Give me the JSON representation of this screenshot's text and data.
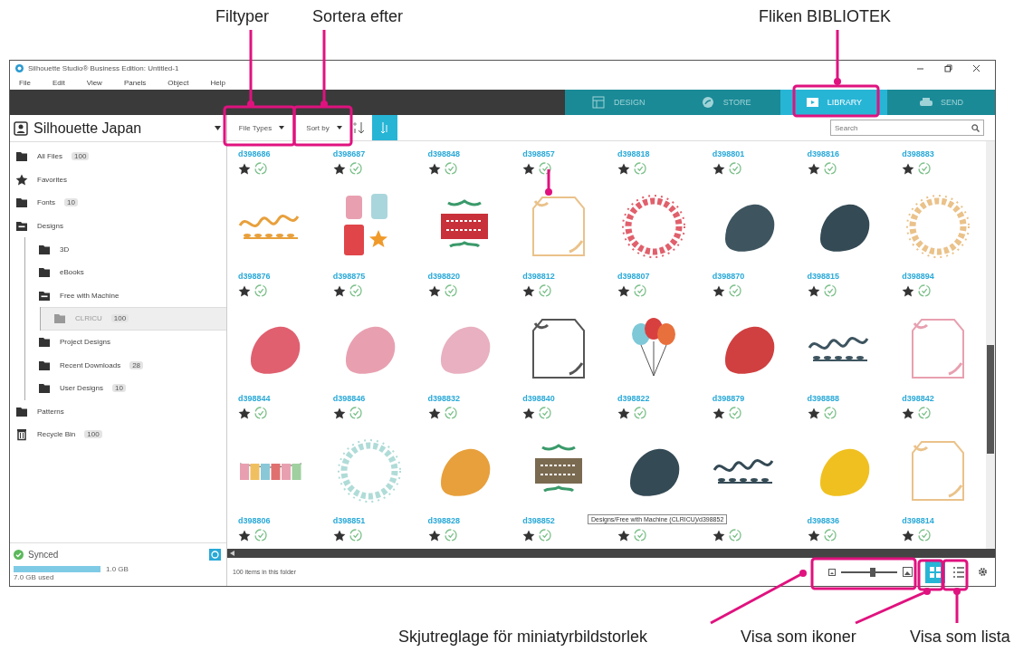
{
  "callouts": [
    {
      "label": "Filtyper"
    },
    {
      "label": "Sortera efter"
    },
    {
      "label": "Fliken BIBLIOTEK"
    },
    {
      "label": "Skjutreglage för miniatyrbildstorlek"
    },
    {
      "label": "Visa som ikoner"
    },
    {
      "label": "Visa som lista"
    }
  ],
  "window": {
    "title": "Silhouette Studio® Business Edition: Untitled-1"
  },
  "menu": [
    "File",
    "Edit",
    "View",
    "Panels",
    "Object",
    "Help"
  ],
  "tabs": [
    {
      "kind": "design",
      "label": "DESIGN",
      "selected": false
    },
    {
      "kind": "store",
      "label": "STORE",
      "selected": false
    },
    {
      "kind": "library",
      "label": "LIBRARY",
      "selected": true
    },
    {
      "kind": "send",
      "label": "SEND",
      "selected": false
    }
  ],
  "sidebar": {
    "account": "Silhouette Japan",
    "items": [
      {
        "kind": "folder",
        "label": "All Files",
        "count": "100",
        "selected": false
      },
      {
        "kind": "star",
        "label": "Favorites",
        "selected": false
      },
      {
        "kind": "folder",
        "label": "Fonts",
        "count": "10",
        "selected": false
      },
      {
        "kind": "folder",
        "label": "Designs",
        "selected": false,
        "expanded": true,
        "children": [
          {
            "kind": "folder",
            "label": "3D",
            "selected": false
          },
          {
            "kind": "folder",
            "label": "eBooks",
            "selected": false
          },
          {
            "kind": "folder",
            "label": "Free with Machine",
            "selected": false,
            "expanded": true,
            "children": [
              {
                "kind": "folder",
                "label": "CLRICU",
                "count": "100",
                "selected": true
              }
            ]
          },
          {
            "kind": "folder",
            "label": "Project Designs",
            "selected": false
          },
          {
            "kind": "folder",
            "label": "Recent Downloads",
            "count": "28",
            "selected": false
          },
          {
            "kind": "folder",
            "label": "User Designs",
            "count": "10",
            "selected": false
          }
        ]
      },
      {
        "kind": "folder",
        "label": "Patterns",
        "selected": false
      },
      {
        "kind": "trash",
        "label": "Recycle Bin",
        "count": "100",
        "selected": false
      }
    ],
    "sync": {
      "status": "Synced"
    },
    "storage": {
      "level": 1,
      "reading": "1.0 GB",
      "caption": "7.0 GB used"
    }
  },
  "toolbar": {
    "file_types": "File Types",
    "sort_by": "Sort by",
    "sort_toggle": {
      "selected": true
    },
    "search": {
      "placeholder": "Search"
    }
  },
  "grid": {
    "tooltip": "Designs/Free with Machine (CLRICU)/d398852",
    "items": [
      {
        "id": "d398686",
        "favorite": true
      },
      {
        "id": "d398687",
        "favorite": true
      },
      {
        "id": "d398848",
        "favorite": true
      },
      {
        "id": "d398857",
        "favorite": true
      },
      {
        "id": "d398818",
        "favorite": true
      },
      {
        "id": "d398801",
        "favorite": true
      },
      {
        "id": "d398816",
        "favorite": true
      },
      {
        "id": "d398883",
        "favorite": true
      },
      {
        "id": "d398876",
        "favorite": true,
        "thumb": {
          "kind": "lettering",
          "color": "#e8a03c"
        }
      },
      {
        "id": "d398875",
        "favorite": true,
        "thumb": {
          "kind": "tags",
          "color": "#e8a0b0"
        }
      },
      {
        "id": "d398820",
        "favorite": true,
        "thumb": {
          "kind": "banner",
          "color": "#c8303a"
        }
      },
      {
        "id": "d398812",
        "favorite": true,
        "thumb": {
          "kind": "frame",
          "color": "#eac28a"
        }
      },
      {
        "id": "d398807",
        "favorite": true,
        "thumb": {
          "kind": "wreath",
          "color": "#e0606c"
        }
      },
      {
        "id": "d398870",
        "favorite": true,
        "thumb": {
          "kind": "blob",
          "color": "#3e5560"
        }
      },
      {
        "id": "d398815",
        "favorite": true,
        "thumb": {
          "kind": "blob",
          "color": "#344a55"
        }
      },
      {
        "id": "d398894",
        "favorite": true,
        "thumb": {
          "kind": "wreath",
          "color": "#eac28a"
        }
      },
      {
        "id": "d398844",
        "favorite": true,
        "thumb": {
          "kind": "blob",
          "color": "#e06070"
        }
      },
      {
        "id": "d398846",
        "favorite": true,
        "thumb": {
          "kind": "blob",
          "color": "#e8a0b0"
        }
      },
      {
        "id": "d398832",
        "favorite": true,
        "thumb": {
          "kind": "blob",
          "color": "#e8b0c0"
        }
      },
      {
        "id": "d398840",
        "favorite": true,
        "thumb": {
          "kind": "frame",
          "color": "#555555"
        }
      },
      {
        "id": "d398822",
        "favorite": true,
        "thumb": {
          "kind": "balloons",
          "color": "#e8703c"
        }
      },
      {
        "id": "d398879",
        "favorite": true,
        "thumb": {
          "kind": "blob",
          "color": "#d04040"
        }
      },
      {
        "id": "d398888",
        "favorite": true,
        "thumb": {
          "kind": "lettering",
          "color": "#3e5560"
        }
      },
      {
        "id": "d398842",
        "favorite": true,
        "thumb": {
          "kind": "frame",
          "color": "#e8a0b0"
        }
      },
      {
        "id": "d398806",
        "favorite": true,
        "thumb": {
          "kind": "bunting",
          "color": "#e8a0b0"
        }
      },
      {
        "id": "d398851",
        "favorite": true,
        "thumb": {
          "kind": "wreath",
          "color": "#b0dcd8"
        }
      },
      {
        "id": "d398828",
        "favorite": true,
        "thumb": {
          "kind": "blob",
          "color": "#e8a03c"
        }
      },
      {
        "id": "d398852",
        "favorite": true,
        "thumb": {
          "kind": "banner",
          "color": "#7a6a50"
        }
      },
      {
        "favorite": true,
        "thumb": {
          "kind": "blob",
          "color": "#344a55"
        }
      },
      {
        "favorite": true,
        "thumb": {
          "kind": "lettering",
          "color": "#344a55"
        }
      },
      {
        "id": "d398836",
        "favorite": true,
        "thumb": {
          "kind": "blob",
          "color": "#f0c020"
        }
      },
      {
        "id": "d398814",
        "favorite": true,
        "thumb": {
          "kind": "frame",
          "color": "#eac28a"
        }
      }
    ]
  },
  "status": {
    "item_count": "100 items in this folder",
    "thumbnail_size": {
      "level": 0.57
    },
    "views": [
      {
        "kind": "icons",
        "selected": true
      },
      {
        "kind": "list",
        "selected": false
      }
    ]
  }
}
